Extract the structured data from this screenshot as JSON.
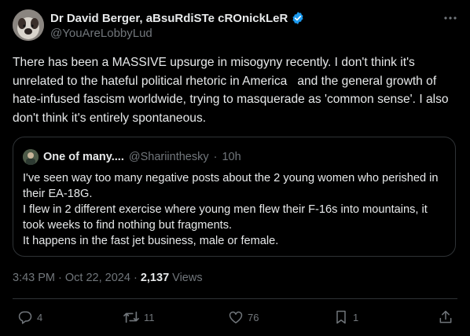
{
  "author": {
    "display_name": "Dr David Berger, aBsuRdiSTe cROnickLeR",
    "handle": "@YouAreLobbyLud",
    "verified_color": "#1d9bf0"
  },
  "tweet": {
    "text": "There has been a MASSIVE upsurge in misogyny recently. I don't think it's unrelated to the hateful political rhetoric in America   and the general growth of hate-infused fascism worldwide, trying to masquerade as 'common sense'. I also don't think it's entirely spontaneous."
  },
  "quote": {
    "name": "One of many....",
    "handle": "@Shariinthesky",
    "separator": "·",
    "time": "10h",
    "lines": [
      "I've seen way too many negative posts about the 2 young women who perished in",
      "their EA-18G.",
      "I flew in 2 different exercise where young men flew their F-16s into mountains, it",
      "took weeks to find nothing but fragments.",
      "It happens in the fast jet business, male or female."
    ]
  },
  "meta": {
    "time": "3:43 PM",
    "separator": "·",
    "date": "Oct 22, 2024",
    "views_count": "2,137",
    "views_label": "Views"
  },
  "actions": {
    "replies": "4",
    "reposts": "11",
    "likes": "76",
    "bookmarks": "1"
  },
  "icons": {
    "verified": "verified-badge-icon",
    "more": "more-options-icon",
    "reply": "reply-icon",
    "repost": "repost-icon",
    "like": "heart-icon",
    "bookmark": "bookmark-icon",
    "share": "share-icon"
  }
}
